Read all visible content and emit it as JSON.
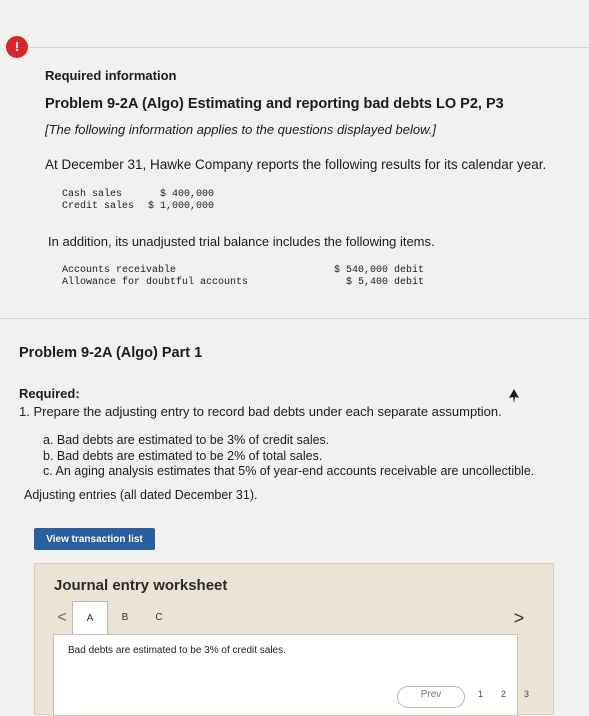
{
  "alert": {
    "glyph": "!"
  },
  "header": {
    "required_info": "Required information",
    "problem_title": "Problem 9-2A (Algo) Estimating and reporting bad debts LO P2, P3",
    "intro": "[The following information applies to the questions displayed below.]",
    "paragraph": "At December 31, Hawke Company reports the following results for its calendar year."
  },
  "sales_table": [
    {
      "label": "Cash sales",
      "value": "$ 400,000"
    },
    {
      "label": "Credit sales",
      "value": "$ 1,000,000"
    }
  ],
  "trial_intro": "In addition, its unadjusted trial balance includes the following items.",
  "trial_table": [
    {
      "label": "Accounts receivable",
      "value": "$ 540,000 debit"
    },
    {
      "label": "Allowance for doubtful accounts",
      "value": "$ 5,400 debit"
    }
  ],
  "part": {
    "title": "Problem 9-2A (Algo) Part 1",
    "required_label": "Required:",
    "required_item": "1. Prepare the adjusting entry to record bad debts under each separate assumption.",
    "assumptions": [
      "a. Bad debts are estimated to be 3% of credit sales.",
      "b. Bad debts are estimated to be 2% of total sales.",
      "c. An aging analysis estimates that 5% of year-end accounts receivable are uncollectible."
    ],
    "adjusting_note": "Adjusting entries (all dated December 31)."
  },
  "buttons": {
    "view_transaction_list": "View transaction list",
    "prev": "Prev"
  },
  "worksheet": {
    "title": "Journal entry worksheet",
    "prev_arrow": "<",
    "next_arrow": ">",
    "tabs": [
      "A",
      "B",
      "C"
    ],
    "active_tab": "A",
    "description": "Bad debts are estimated to be 3% of credit sales."
  },
  "pagination": [
    "1",
    "2",
    "3"
  ],
  "colors": {
    "alert": "#d8262f",
    "button": "#2a5f9e",
    "worksheet_bg": "#ece3d7"
  }
}
